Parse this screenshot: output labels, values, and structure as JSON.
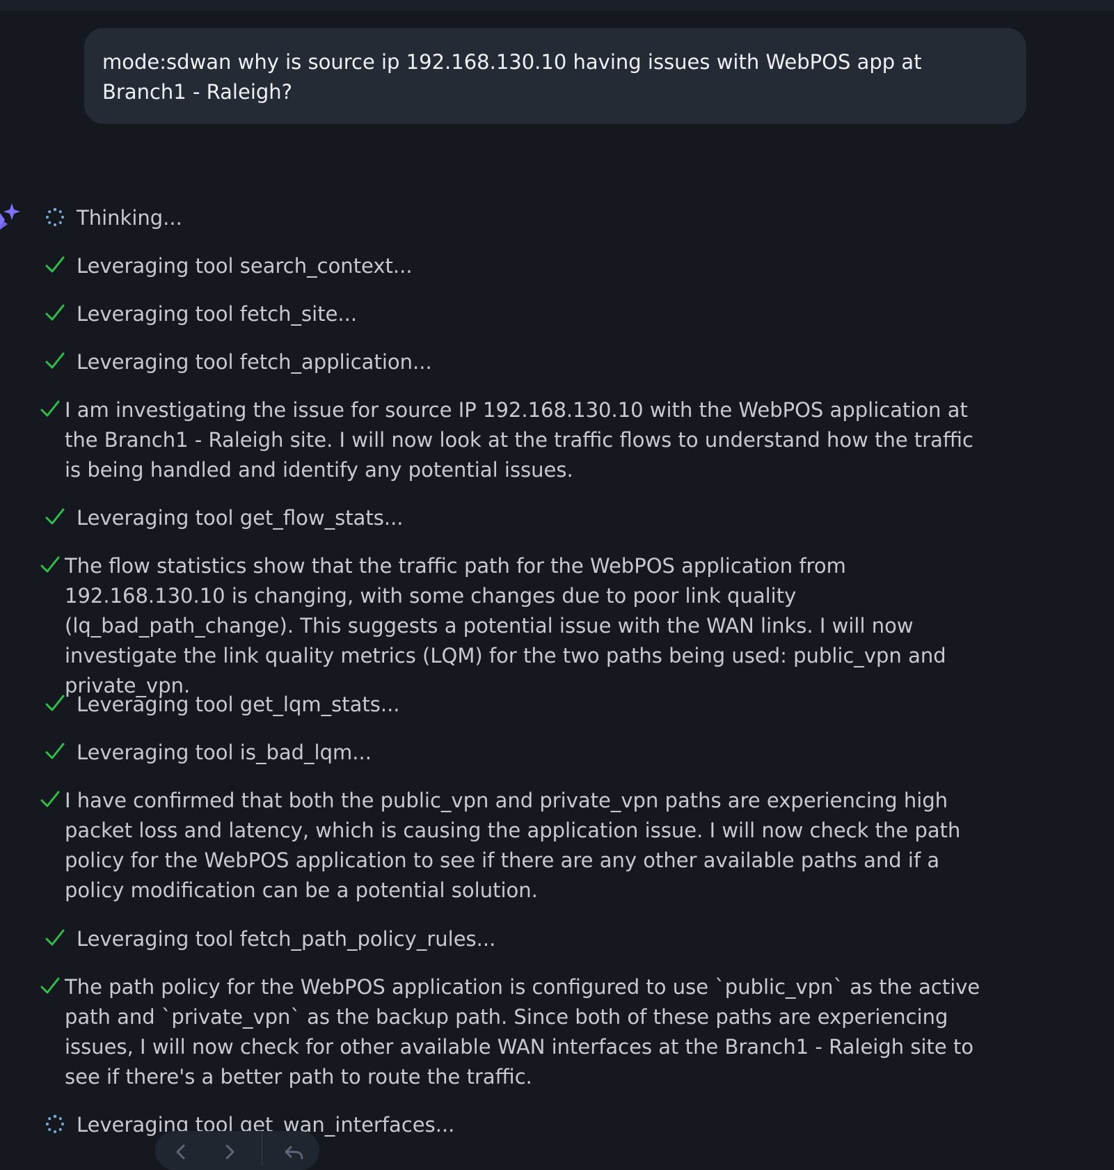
{
  "query": {
    "text": "mode:sdwan why is source ip 192.168.130.10 having issues with WebPOS app at Branch1 - Raleigh?"
  },
  "assistant": {
    "avatar_icon": "sparkle-icon",
    "accent_color": "#7f72ff",
    "check_color": "#2fbf48",
    "spinner_color": "#78a9d8"
  },
  "steps": [
    {
      "status": "in-progress",
      "icon": "spinner-icon",
      "text": "Thinking..."
    },
    {
      "status": "done",
      "icon": "check-icon",
      "text": "Leveraging tool search_context..."
    },
    {
      "status": "done",
      "icon": "check-icon",
      "text": "Leveraging tool fetch_site..."
    },
    {
      "status": "done",
      "icon": "check-icon",
      "text": "Leveraging tool fetch_application..."
    },
    {
      "status": "done",
      "icon": "check-icon",
      "text": "I am investigating the issue for source IP 192.168.130.10 with the WebPOS application at the Branch1 - Raleigh site. I will now look at the traffic flows to understand how the traffic is being handled and identify any potential issues."
    },
    {
      "status": "done",
      "icon": "check-icon",
      "text": "Leveraging tool get_flow_stats..."
    },
    {
      "status": "done",
      "icon": "check-icon",
      "text": "The flow statistics show that the traffic path for the WebPOS application from 192.168.130.10 is changing, with some changes due to poor link quality (lq_bad_path_change). This suggests a potential issue with the WAN links. I will now investigate the link quality metrics (LQM) for the two paths being used: public_vpn and private_vpn."
    },
    {
      "status": "done",
      "icon": "check-icon",
      "text": "Leveraging tool get_lqm_stats..."
    },
    {
      "status": "done",
      "icon": "check-icon",
      "text": "Leveraging tool is_bad_lqm..."
    },
    {
      "status": "done",
      "icon": "check-icon",
      "text": "I have confirmed that both the public_vpn and private_vpn paths are experiencing high packet loss and latency, which is causing the application issue. I will now check the path policy for the WebPOS application to see if there are any other available paths and if a policy modification can be a potential solution."
    },
    {
      "status": "done",
      "icon": "check-icon",
      "text": "Leveraging tool fetch_path_policy_rules..."
    },
    {
      "status": "done",
      "icon": "check-icon",
      "text": "The path policy for the WebPOS application is configured to use `public_vpn` as the active path and `private_vpn` as the backup path. Since both of these paths are experiencing issues, I will now check for other available WAN interfaces at the Branch1 - Raleigh site to see if there's a better path to route the traffic."
    },
    {
      "status": "in-progress",
      "icon": "spinner-icon",
      "text": "Leveraging tool get_wan_interfaces..."
    }
  ],
  "bottom_nav": {
    "previous_icon": "chevron-left-icon",
    "next_icon": "chevron-right-icon",
    "retry_icon": "undo-icon"
  }
}
